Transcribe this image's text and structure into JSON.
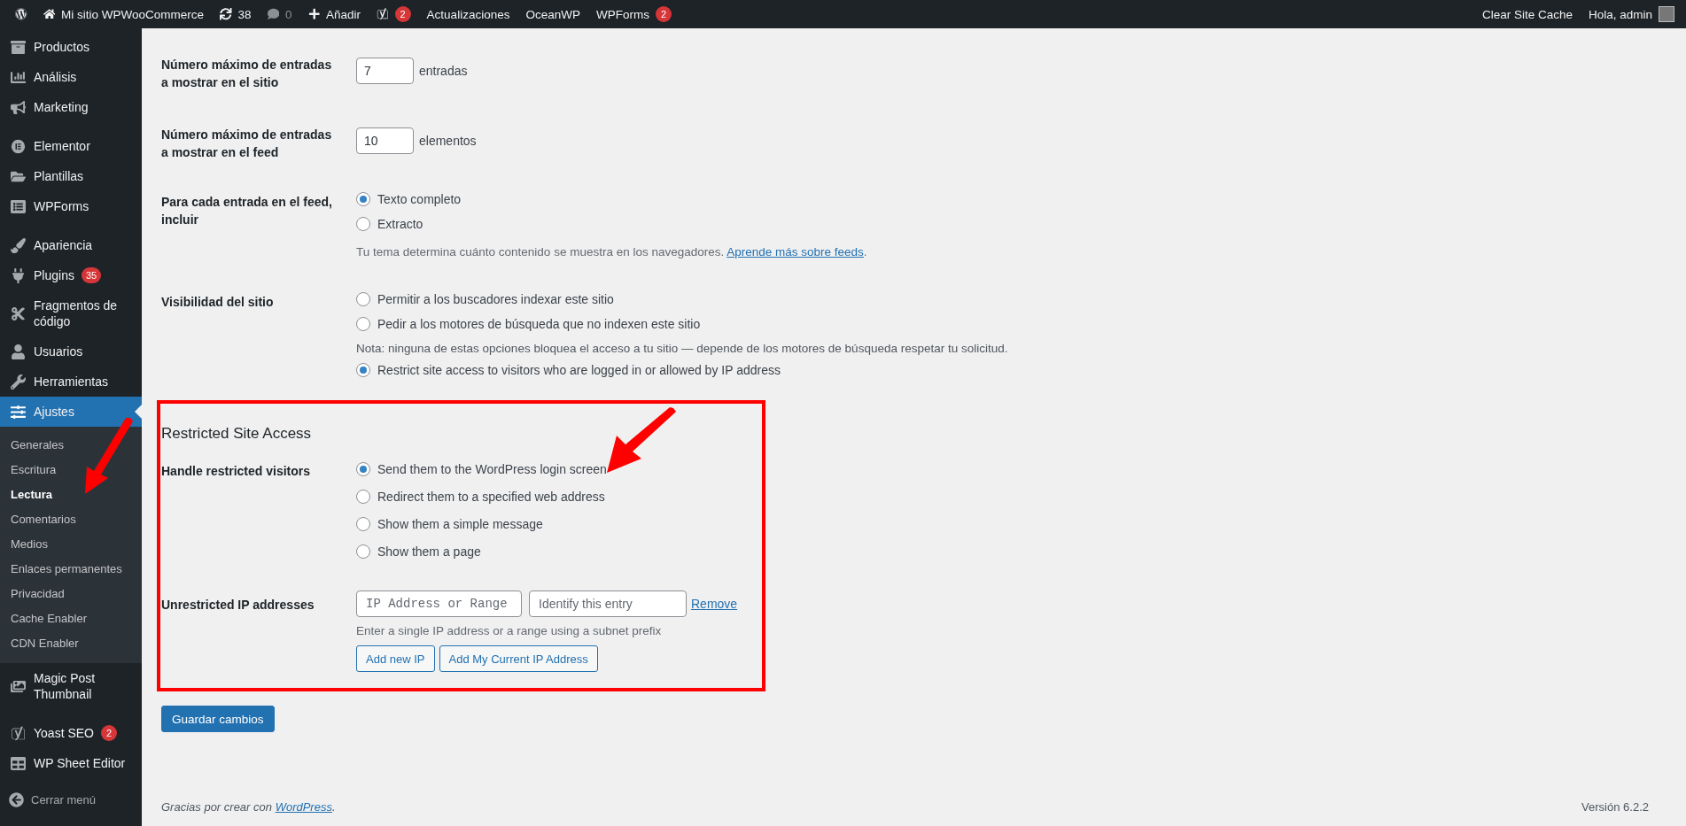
{
  "admin_bar": {
    "left": [
      {
        "kind": "logo"
      },
      {
        "kind": "site",
        "label": "Mi sitio WPWooCommerce"
      },
      {
        "kind": "updates",
        "label": "38"
      },
      {
        "kind": "comments",
        "label": "0"
      },
      {
        "kind": "new",
        "label": "Añadir"
      },
      {
        "kind": "seo",
        "badge": "2"
      },
      {
        "kind": "text",
        "label": "Actualizaciones"
      },
      {
        "kind": "text",
        "label": "OceanWP"
      },
      {
        "kind": "text",
        "label": "WPForms",
        "badge": "2"
      }
    ],
    "right": [
      {
        "kind": "text",
        "label": "Clear Site Cache"
      },
      {
        "kind": "account",
        "label": "Hola, admin"
      }
    ]
  },
  "sidebar": {
    "groups": [
      [
        {
          "label": "Productos",
          "selected": false
        },
        {
          "label": "Análisis",
          "selected": false
        },
        {
          "label": "Marketing",
          "selected": false
        }
      ],
      [
        {
          "label": "Elementor",
          "selected": false
        },
        {
          "label": "Plantillas",
          "selected": false
        },
        {
          "label": "WPForms",
          "selected": false
        }
      ],
      [
        {
          "label": "Apariencia",
          "selected": false
        },
        {
          "label": "Plugins",
          "badge": "35",
          "selected": false
        },
        {
          "label": "Fragmentos de código",
          "selected": false
        },
        {
          "label": "Usuarios",
          "selected": false
        },
        {
          "label": "Herramientas",
          "selected": false
        },
        {
          "label": "Ajustes",
          "selected": true,
          "children": [
            {
              "label": "Generales",
              "selected": false
            },
            {
              "label": "Escritura",
              "selected": false
            },
            {
              "label": "Lectura",
              "selected": true
            },
            {
              "label": "Comentarios",
              "selected": false
            },
            {
              "label": "Medios",
              "selected": false
            },
            {
              "label": "Enlaces permanentes",
              "selected": false
            },
            {
              "label": "Privacidad",
              "selected": false
            },
            {
              "label": "Cache Enabler",
              "selected": false
            },
            {
              "label": "CDN Enabler",
              "selected": false
            }
          ]
        },
        {
          "label": "Magic Post Thumbnail",
          "selected": false
        }
      ],
      [
        {
          "label": "Yoast SEO",
          "badge": "2",
          "selected": false
        },
        {
          "label": "WP Sheet Editor",
          "selected": false
        }
      ]
    ],
    "collapse": "Cerrar menú"
  },
  "settings": [
    {
      "kind": "number",
      "label": "Número máximo de entradas a mostrar en el sitio",
      "value": "7",
      "unit": "entradas"
    },
    {
      "kind": "number",
      "label": "Número máximo de entradas a mostrar en el feed",
      "value": "10",
      "unit": "elementos"
    },
    {
      "kind": "choices",
      "label": "Para cada entrada en el feed, incluir",
      "items": [
        {
          "kind": "radio",
          "label": "Texto completo",
          "selected": true
        },
        {
          "kind": "radio",
          "label": "Extracto",
          "selected": false
        },
        {
          "kind": "description",
          "text": "Tu tema determina cuánto contenido se muestra en los navegadores.",
          "link": "Aprende más sobre feeds",
          "after": "."
        }
      ]
    },
    {
      "kind": "choices",
      "label": "Visibilidad del sitio",
      "items": [
        {
          "kind": "radio",
          "label": "Permitir a los buscadores indexar este sitio",
          "selected": false
        },
        {
          "kind": "radio",
          "label": "Pedir a los motores de búsqueda que no indexen este sitio",
          "selected": false
        },
        {
          "kind": "note",
          "text": "Nota: ninguna de estas opciones bloquea el acceso a tu sitio — depende de los motores de búsqueda respetar tu solicitud."
        },
        {
          "kind": "radio",
          "label": "Restrict site access to visitors who are logged in or allowed by IP address",
          "selected": true
        }
      ]
    }
  ],
  "restricted_access": {
    "title": "Restricted Site Access",
    "visitors": {
      "label": "Handle restricted visitors",
      "options": [
        {
          "label": "Send them to the WordPress login screen",
          "selected": true
        },
        {
          "label": "Redirect them to a specified web address",
          "selected": false
        },
        {
          "label": "Show them a simple message",
          "selected": false
        },
        {
          "label": "Show them a page",
          "selected": false
        }
      ]
    },
    "ip": {
      "label": "Unrestricted IP addresses",
      "address_placeholder": "IP Address or Range",
      "entry_placeholder": "Identify this entry",
      "remove_link": "Remove",
      "hint": "Enter a single IP address or a range using a subnet prefix",
      "buttons": [
        "Add new IP",
        "Add My Current IP Address"
      ]
    }
  },
  "save_button": "Guardar cambios",
  "footer": {
    "text": "Gracias por crear con",
    "link": "WordPress",
    "after": ".",
    "version": "Versión 6.2.2"
  }
}
